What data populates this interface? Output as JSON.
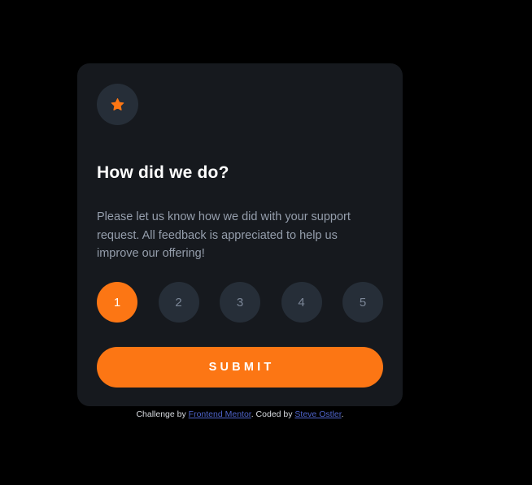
{
  "card": {
    "icon": "star-icon",
    "title": "How did we do?",
    "description": "Please let us know how we did with your support request. All feedback is appreciated to help us improve our offering!",
    "ratings": [
      "1",
      "2",
      "3",
      "4",
      "5"
    ],
    "selected_rating": "1",
    "submit_label": "SUBMIT"
  },
  "attribution": {
    "prefix": "Challenge by ",
    "challenge_link": "Frontend Mentor",
    "middle": ". Coded by ",
    "author_link": "Steve Ostler",
    "suffix": "."
  },
  "colors": {
    "page_background": "#000000",
    "card_background": "#16191e",
    "accent": "#fc7614",
    "rating_background": "#262e38",
    "text_muted": "#959eac",
    "link": "#4e63c9"
  }
}
